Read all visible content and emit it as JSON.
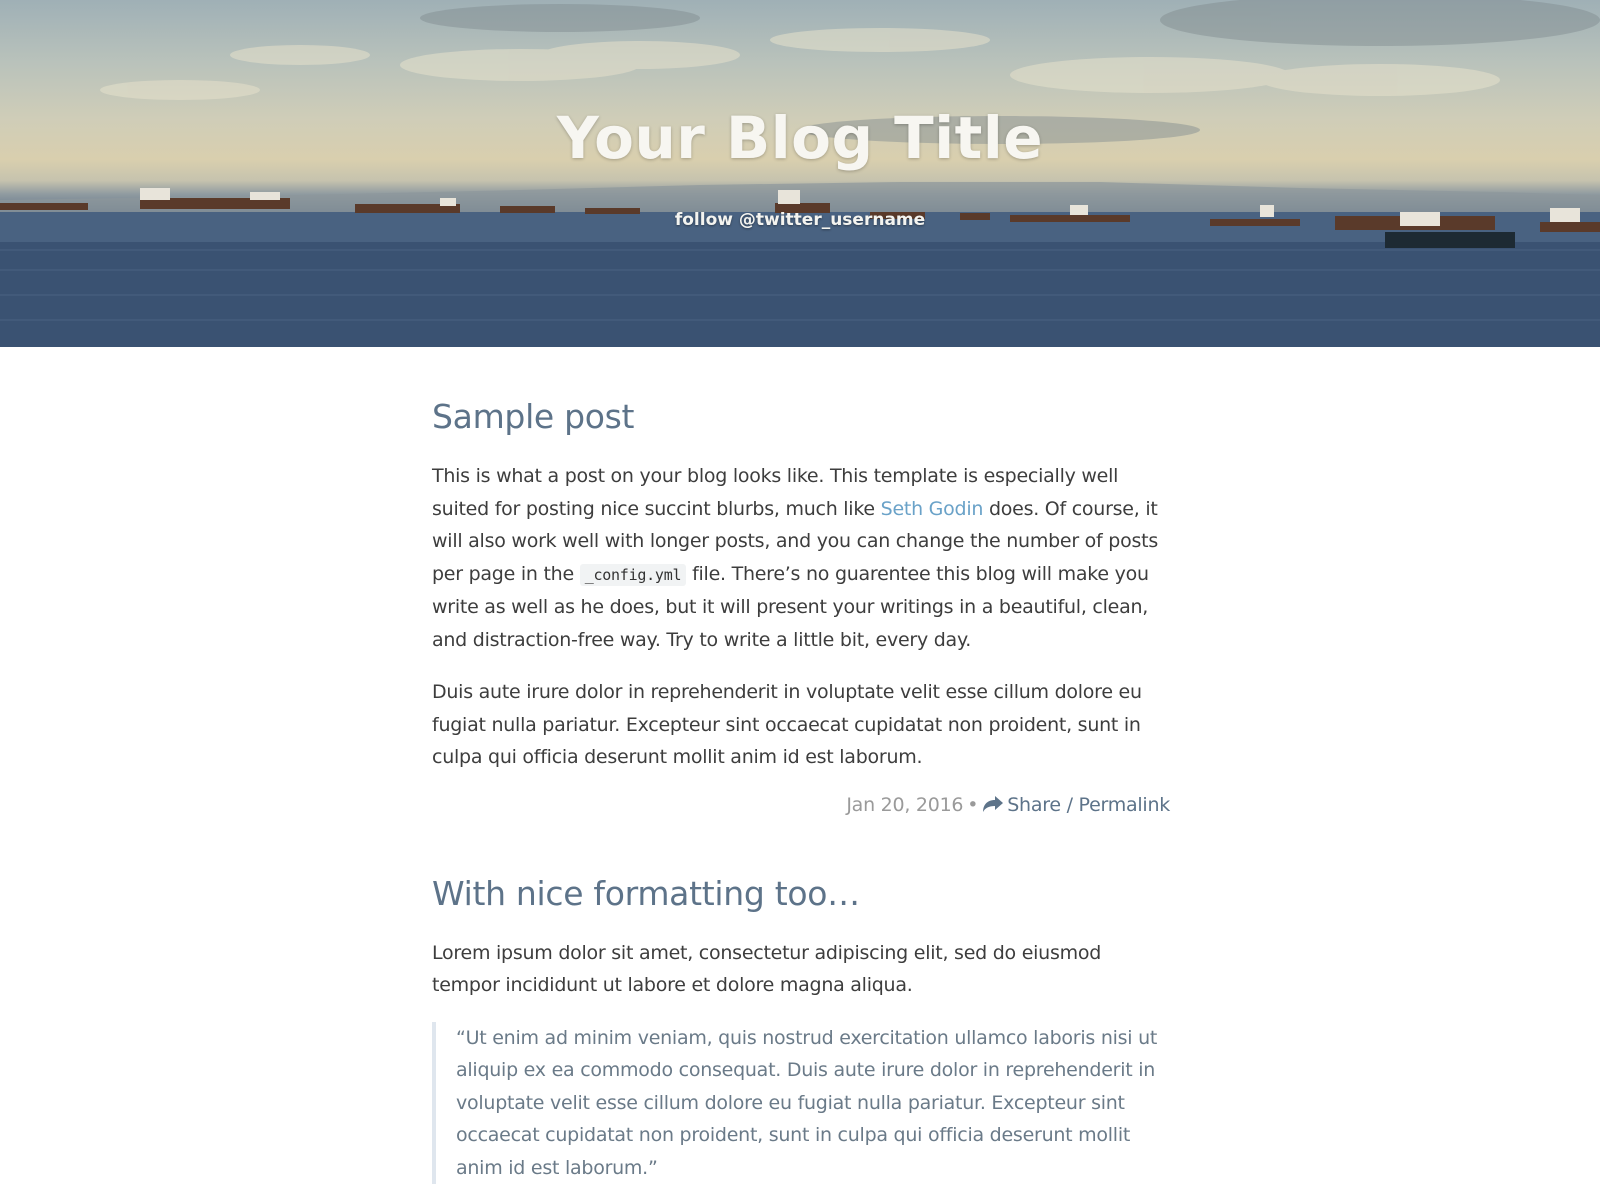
{
  "header": {
    "title": "Your Blog Title",
    "subtitle": "follow @twitter_username"
  },
  "posts": [
    {
      "title": "Sample post",
      "paragraph1": {
        "before_link": "This is what a post on your blog looks like. This template is especially well suited for posting nice succint blurbs, much like ",
        "link_text": "Seth Godin",
        "after_link": " does. Of course, it will also work well with longer posts, and you can change the number of posts per page in the ",
        "code": "_config.yml",
        "after_code": " file. There’s no guarentee this blog will make you write as well as he does, but it will present your writings in a beautiful, clean, and distraction-free way. Try to write a little bit, every day."
      },
      "paragraph2": "Duis aute irure dolor in reprehenderit in voluptate velit esse cillum dolore eu fugiat nulla pariatur. Excepteur sint occaecat cupidatat non proident, sunt in culpa qui officia deserunt mollit anim id est laborum.",
      "date": "Jan 20, 2016",
      "separator": "•",
      "share_label": "Share / Permalink"
    },
    {
      "title": "With nice formatting too…",
      "paragraph1": "Lorem ipsum dolor sit amet, consectetur adipiscing elit, sed do eiusmod tempor incididunt ut labore et dolore magna aliqua.",
      "quote": "“Ut enim ad minim veniam, quis nostrud exercitation ullamco laboris nisi ut aliquip ex ea commodo consequat. Duis aute irure dolor in reprehenderit in voluptate velit esse cillum dolore eu fugiat nulla pariatur. Excepteur sint occaecat cupidatat non proident, sunt in culpa qui officia deserunt mollit anim id est laborum.”"
    }
  ],
  "colors": {
    "title": "#5d7389",
    "link": "#6aa2c8",
    "meta": "#9a9a9a",
    "quote_border": "#dfe6ee"
  },
  "icons": {
    "share": "share-arrow-icon"
  }
}
